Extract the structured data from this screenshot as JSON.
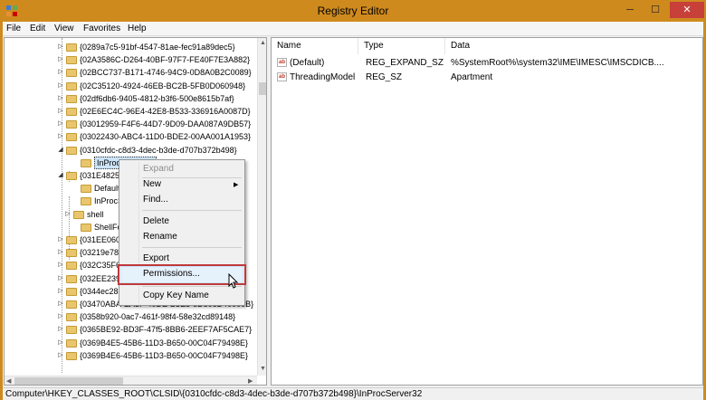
{
  "window": {
    "title": "Registry Editor",
    "minimize_glyph": "─",
    "maximize_glyph": "☐",
    "close_glyph": "✕"
  },
  "menu": [
    "File",
    "Edit",
    "View",
    "Favorites",
    "Help"
  ],
  "tree": [
    {
      "label": "{0289a7c5-91bf-4547-81ae-fec91a89dec5}"
    },
    {
      "label": "{02A3586C-D264-40BF-97F7-FE40F7E3A882}"
    },
    {
      "label": "{02BCC737-B171-4746-94C9-0D8A0B2C0089}"
    },
    {
      "label": "{02C35120-4924-46EB-BC2B-5FB0D060948}"
    },
    {
      "label": "{02df6db6-9405-4812-b3f6-500e8615b7af}"
    },
    {
      "label": "{02E6EC4C-96E4-42E8-B533-336916A0087D}"
    },
    {
      "label": "{03012959-F4F6-44D7-9D09-DAA087A9DB57}"
    },
    {
      "label": "{03022430-ABC4-11D0-BDE2-00AA001A1953}"
    },
    {
      "label": "{0310cfdc-c8d3-4dec-b3de-d707b372b498}"
    },
    {
      "label": "InProcServer32"
    },
    {
      "label": "{031E4825-"
    },
    {
      "label": "Default"
    },
    {
      "label": "InProcS"
    },
    {
      "label": "shell"
    },
    {
      "label": "ShellFo"
    },
    {
      "label": "{031EE060-"
    },
    {
      "label": "{03219e78-"
    },
    {
      "label": "{032C35F6"
    },
    {
      "label": "{032EE239-"
    },
    {
      "label": "{0344ec28-"
    },
    {
      "label": "{03470ABA-EA3F-40DE-B3E3-8D806D40000B}"
    },
    {
      "label": "{0358b920-0ac7-461f-98f4-58e32cd89148}"
    },
    {
      "label": "{0365BE92-BD3F-47f5-8BB6-2EEF7AF5CAE7}"
    },
    {
      "label": "{0369B4E5-45B6-11D3-B650-00C04F79498E}"
    },
    {
      "label": "{0369B4E6-45B6-11D3-B650-00C04F79498E}"
    }
  ],
  "list": {
    "headers": {
      "name": "Name",
      "type": "Type",
      "data": "Data"
    },
    "rows": [
      {
        "name": "(Default)",
        "type": "REG_EXPAND_SZ",
        "data": "%SystemRoot%\\system32\\IME\\IMESC\\IMSCDICB...."
      },
      {
        "name": "ThreadingModel",
        "type": "REG_SZ",
        "data": "Apartment"
      }
    ]
  },
  "context_menu": {
    "expand": "Expand",
    "new": "New",
    "find": "Find...",
    "delete": "Delete",
    "rename": "Rename",
    "export": "Export",
    "permissions": "Permissions...",
    "copy_key_name": "Copy Key Name"
  },
  "statusbar": {
    "path": "Computer\\HKEY_CLASSES_ROOT\\CLSID\\{0310cfdc-c8d3-4dec-b3de-d707b372b498}\\InProcServer32"
  },
  "colors": {
    "titlebar": "#cf8a1e",
    "close": "#c7403a",
    "highlight": "#c0393b",
    "selection": "#cce4f7"
  }
}
